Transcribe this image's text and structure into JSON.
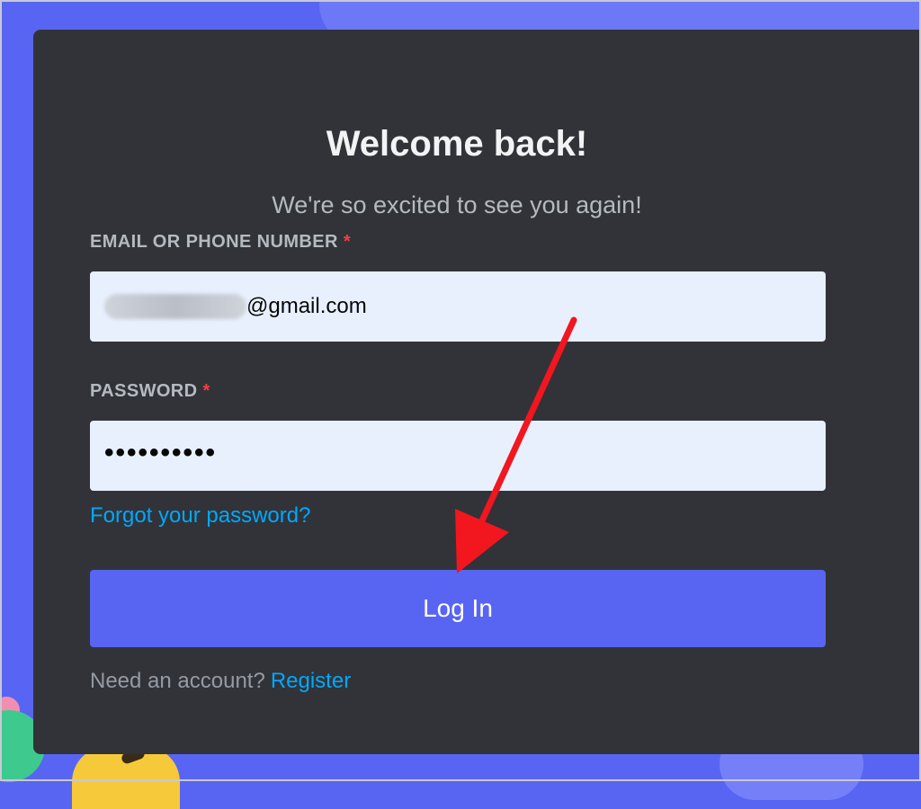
{
  "login": {
    "title": "Welcome back!",
    "subtitle": "We're so excited to see you again!",
    "email_label": "EMAIL OR PHONE NUMBER",
    "required_mark": "*",
    "email_value": "@gmail.com",
    "password_label": "PASSWORD",
    "password_value": "••••••••••",
    "forgot_link": "Forgot your password?",
    "login_button": "Log In",
    "need_account_text": "Need an account?",
    "register_link": "Register"
  },
  "colors": {
    "background": "#5865f2",
    "card": "#313338",
    "input_bg": "#e8f0fe",
    "button": "#5865f2",
    "link": "#00a8fc",
    "required": "#f23f42",
    "annotation_arrow": "#f2161f"
  },
  "annotation": {
    "arrow_target": "login_button"
  }
}
